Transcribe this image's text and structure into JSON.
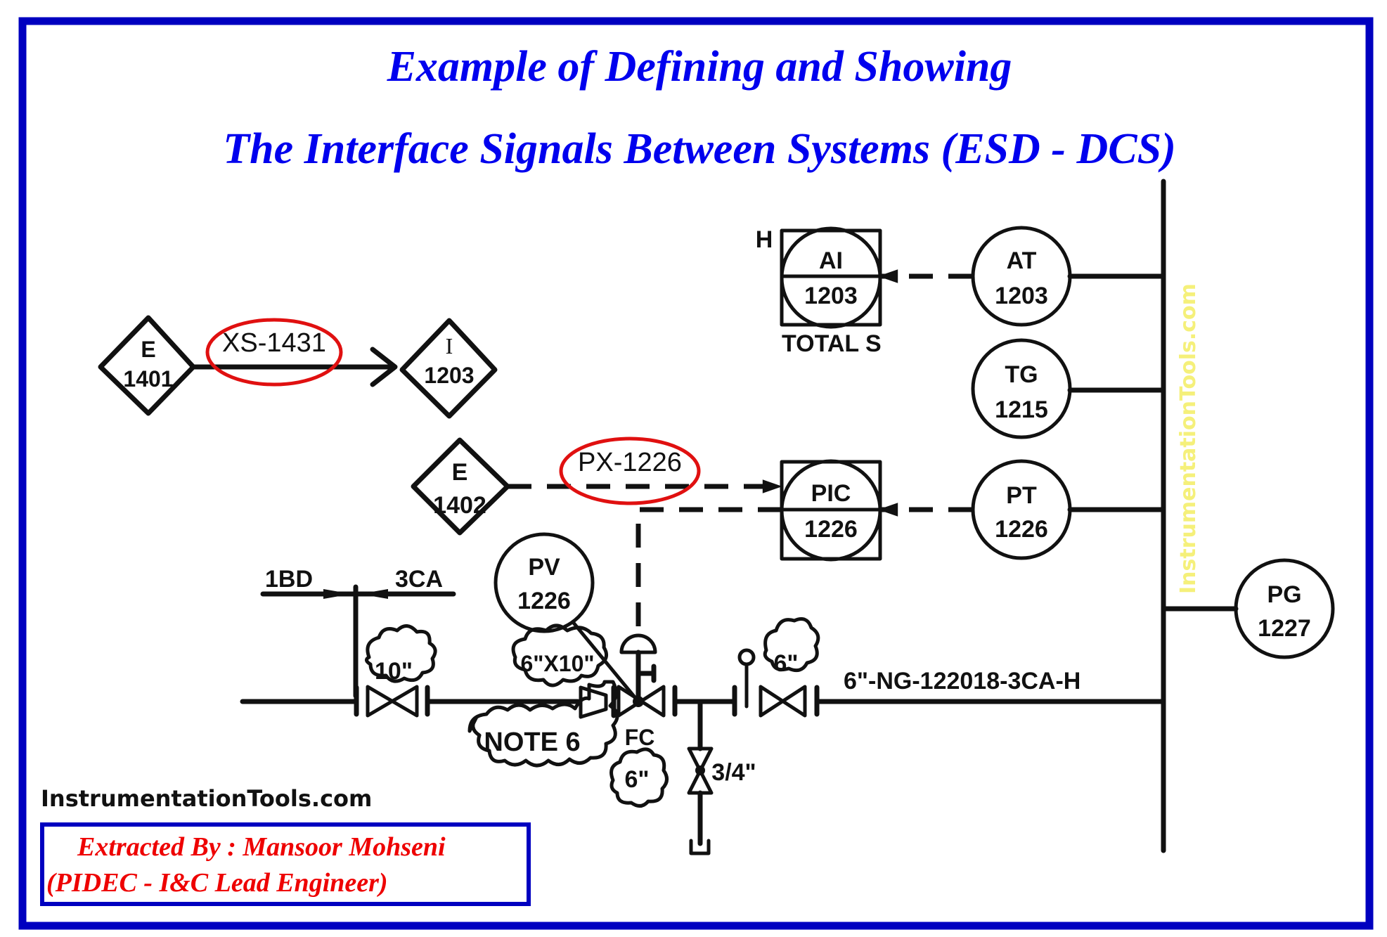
{
  "title": {
    "line1": "Example of Defining and Showing",
    "line2": "The Interface Signals Between Systems (ESD - DCS)",
    "color": "#0000ee"
  },
  "colors": {
    "border": "#0000c0",
    "highlight_ellipse": "#e01010",
    "credit_text": "#ee0000",
    "watermark": "#f5f07a"
  },
  "signals": [
    {
      "tag": "XS-1431",
      "from": "E 1401",
      "to": "I 1203",
      "line": "solid",
      "highlighted": true
    },
    {
      "tag": "PX-1226",
      "from": "E 1402",
      "to": "PIC 1226",
      "line": "dashed",
      "highlighted": true
    }
  ],
  "diamonds": {
    "e1401": {
      "letter": "E",
      "number": "1401"
    },
    "i1203": {
      "letter": "I",
      "number": "1203"
    },
    "e1402": {
      "letter": "E",
      "number": "1402"
    }
  },
  "instruments": {
    "ai": {
      "letters": "AI",
      "number": "1203",
      "alarm": "H",
      "note": "TOTAL S"
    },
    "at": {
      "letters": "AT",
      "number": "1203"
    },
    "tg": {
      "letters": "TG",
      "number": "1215"
    },
    "pic": {
      "letters": "PIC",
      "number": "1226"
    },
    "pt": {
      "letters": "PT",
      "number": "1226"
    },
    "pg": {
      "letters": "PG",
      "number": "1227"
    },
    "pv": {
      "letters": "PV",
      "number": "1226"
    }
  },
  "piping": {
    "spec_left": "1BD",
    "spec_right": "3CA",
    "valve_10": "10\"",
    "reducer": "6\"X10\"",
    "note": "NOTE 6",
    "fail_mode": "FC",
    "cv_size": "6\"",
    "handle_indicator": "H",
    "valve_6": "6\"",
    "drain_size": "3/4\"",
    "line_number": "6\"-NG-122018-3CA-H"
  },
  "watermark_vertical": "InstrumentationTools.com",
  "footer": {
    "site": "InstrumentationTools.com",
    "credit_line1": "Extracted By : Mansoor Mohseni",
    "credit_line2": "(PIDEC - I&C Lead Engineer)"
  }
}
